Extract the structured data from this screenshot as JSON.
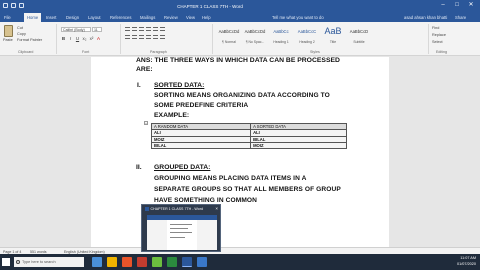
{
  "window": {
    "title": "CHAPTER 1 CLASS 7TH - Word",
    "controls": [
      "–",
      "□",
      "✕"
    ]
  },
  "tabs": [
    "File",
    "Home",
    "Insert",
    "Design",
    "Layout",
    "References",
    "Mailings",
    "Review",
    "View",
    "Help"
  ],
  "active_tab": "Home",
  "tell_me": "Tell me what you want to do",
  "user_name": "asad ahsan khan bhatti",
  "share_label": "Share",
  "ribbon": {
    "clipboard": {
      "paste": "Paste",
      "cut": "Cut",
      "copy": "Copy",
      "format_painter": "Format Painter",
      "group": "Clipboard"
    },
    "font": {
      "name": "Calibri (Body)",
      "size": "11",
      "group": "Font",
      "format_buttons": [
        "B",
        "I",
        "U",
        "x₂",
        "x²",
        "A"
      ]
    },
    "paragraph": {
      "group": "Paragraph"
    },
    "styles": {
      "group": "Styles",
      "items": [
        {
          "sample": "AaBbCcDd",
          "name": "¶ Normal",
          "kind": "normal"
        },
        {
          "sample": "AaBbCcDd",
          "name": "¶ No Spac...",
          "kind": "normal"
        },
        {
          "sample": "AaBbCc",
          "name": "Heading 1",
          "kind": "h"
        },
        {
          "sample": "AaBbCcC",
          "name": "Heading 2",
          "kind": "h"
        },
        {
          "sample": "AaB",
          "name": "Title",
          "kind": "big"
        },
        {
          "sample": "AaBbCcD",
          "name": "Subtitle",
          "kind": "normal"
        }
      ]
    },
    "editing": {
      "find": "Find",
      "replace": "Replace",
      "select": "Select",
      "group": "Editing"
    }
  },
  "document": {
    "heading": "ANS: THE THREE WAYS IN WHICH DATA CAN BE PROCESSED",
    "heading_cont": "ARE:",
    "item1_num": "I.",
    "item1_title": "SORTED DATA:",
    "item1_body_1": "SORTING MEANS ORGANIZING DATA ACCORDING TO",
    "item1_body_2": "SOME PREDEFINE CRITERIA",
    "example_label": "EXAMPLE:",
    "table": {
      "headers": [
        "A RANDOM DATA",
        "A SORTED DATA"
      ],
      "rows": [
        [
          "ALI",
          "ALI"
        ],
        [
          "MOIZ",
          "BILAL"
        ],
        [
          "BILAL",
          "MOIZ"
        ]
      ]
    },
    "item2_num": "II.",
    "item2_title": "GROUPED DATA:",
    "item2_body_1": "GROUPING MEANS PLACING DATA ITEMS IN A",
    "item2_body_2": "SEPARATE GROUPS SO THAT ALL MEMBERS OF GROUP",
    "item2_body_3": "HAVE SOMETHING IN COMMON"
  },
  "statusbar": {
    "page": "Page 1 of 4",
    "words": "551 words",
    "language": "English (United Kingdom)"
  },
  "taskbar": {
    "search_placeholder": "Type here to search",
    "preview_title": "CHAPTER 1 CLASS 7TH - Word",
    "time": "11:07 AM",
    "date": "01/07/2020",
    "icon_colors": [
      "#4a90d9",
      "#f0b400",
      "#e8542a",
      "#c43c2f",
      "#6cbf3f",
      "#2b8a3e",
      "#2b579a",
      "#3a78c9"
    ]
  }
}
